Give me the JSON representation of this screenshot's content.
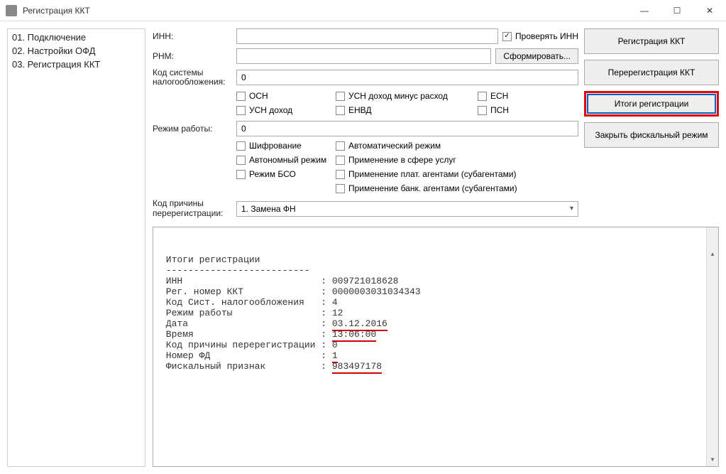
{
  "window": {
    "title": "Регистрация ККТ"
  },
  "sidebar": {
    "items": [
      {
        "label": "01. Подключение"
      },
      {
        "label": "02. Настройки ОФД"
      },
      {
        "label": "03. Регистрация ККТ"
      }
    ]
  },
  "form": {
    "inn_label": "ИНН:",
    "inn_value": "",
    "check_inn_label": "Проверять ИНН",
    "check_inn_checked": true,
    "rnm_label": "РНМ:",
    "rnm_value": "",
    "generate_btn": "Сформировать...",
    "tax_code_label_line1": "Код системы",
    "tax_code_label_line2": "налогообложения:",
    "tax_code_value": "0",
    "tax_checks": {
      "osn": "ОСН",
      "usn_dmr": "УСН доход минус расход",
      "esn": "ЕСН",
      "usn_d": "УСН доход",
      "envd": "ЕНВД",
      "psn": "ПСН"
    },
    "mode_label": "Режим работы:",
    "mode_value": "0",
    "mode_checks": {
      "cipher": "Шифрование",
      "auto": "Автоматический режим",
      "autonom": "Автономный режим",
      "services": "Применение в сфере услуг",
      "bso": "Режим БСО",
      "plat": "Применение плат. агентами (субагентами)",
      "bank": "Применение банк. агентами (субагентами)"
    },
    "rereg_label_line1": "Код причины",
    "rereg_label_line2": "перерегистрации:",
    "rereg_select": "1. Замена ФН"
  },
  "buttons": {
    "register": "Регистрация ККТ",
    "reregister": "Перерегистрация ККТ",
    "results": "Итоги регистрации",
    "close_fiscal": "Закрыть фискальный режим"
  },
  "output": {
    "title": "Итоги регистрации",
    "divider": "--------------------------",
    "rows": [
      {
        "k": "ИНН",
        "v": "009721018628"
      },
      {
        "k": "Рег. номер ККТ",
        "v": "0000003031034343"
      },
      {
        "k": "Код Сист. налогообложения",
        "v": "4"
      },
      {
        "k": "Режим работы",
        "v": "12"
      },
      {
        "k": "Дата",
        "v": "03.12.2016",
        "underline": true
      },
      {
        "k": "Время",
        "v": "13:06:00",
        "underline": true
      },
      {
        "k": "Код причины перерегистрации",
        "v": "0"
      },
      {
        "k": "Номер ФД",
        "v": "1",
        "underline": true
      },
      {
        "k": "Фискальный признак",
        "v": "983497178",
        "underline": true
      }
    ]
  }
}
